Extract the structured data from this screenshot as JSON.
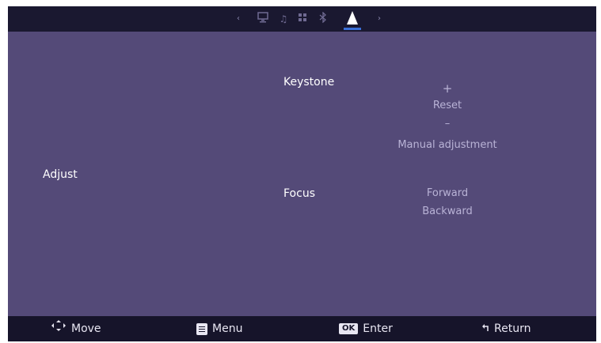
{
  "topbar": {
    "icons": [
      {
        "name": "left-arrow-icon",
        "glyph": "‹"
      },
      {
        "name": "monitor-icon",
        "glyph": "🖵"
      },
      {
        "name": "music-icon",
        "glyph": "♫"
      },
      {
        "name": "apps-icon",
        "glyph": "▪▪"
      },
      {
        "name": "bluetooth-icon",
        "glyph": "✱"
      },
      {
        "name": "projector-settings-icon",
        "glyph": "▲"
      },
      {
        "name": "right-arrow-icon",
        "glyph": "›"
      }
    ],
    "active_icon": "projector-settings-icon",
    "accent_color": "#3a6fd8"
  },
  "main": {
    "section_label": "Adjust",
    "keystone": {
      "label": "Keystone",
      "options": [
        "+",
        "Reset",
        "–",
        "Manual adjustment"
      ]
    },
    "focus": {
      "label": "Focus",
      "options": [
        "Forward",
        "Backward"
      ]
    }
  },
  "bottombar": {
    "move_label": "Move",
    "menu_label": "Menu",
    "ok_badge": "OK",
    "enter_label": "Enter",
    "return_label": "Return"
  }
}
